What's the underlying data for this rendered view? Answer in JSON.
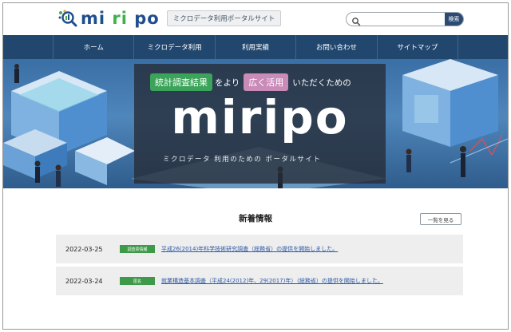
{
  "header": {
    "logo_prefix": "mi",
    "logo_mid": "ri",
    "logo_suffix": " po",
    "logo_subtitle": "ミクロデータ利用ポータルサイト",
    "search_placeholder": "",
    "search_button": "検索"
  },
  "nav": {
    "items": [
      {
        "label": "ホーム"
      },
      {
        "label": "ミクロデータ利用"
      },
      {
        "label": "利用実績"
      },
      {
        "label": "お問い合わせ"
      },
      {
        "label": "サイトマップ"
      }
    ]
  },
  "hero": {
    "tag1": "統計調査結果",
    "text1": "をより",
    "tag2": "広く活用",
    "text2": "いただくための",
    "title": "miripo",
    "subtitle": "ミクロデータ 利用のための ポータルサイト"
  },
  "news": {
    "heading": "新着情報",
    "all_button": "一覧を見る",
    "items": [
      {
        "date": "2022-03-25",
        "tag": "調査票情報",
        "title": "平成26(2014)年科学技術研究調査（総務省）の提供を開始しました。"
      },
      {
        "date": "2022-03-24",
        "tag": "匿名",
        "title": "就業構造基本調査（平成24(2012)年、29(2017)年）（総務省）の提供を開始しました。"
      }
    ]
  },
  "colors": {
    "nav_bg": "#21476f",
    "brand_blue": "#1f4e8f",
    "brand_green": "#3fb04b",
    "tag_green": "#3ba45a",
    "tag_pink": "#c98bb8",
    "news_tag": "#3e9a49",
    "link": "#2a57a6"
  },
  "icons": {
    "logo": "magnifier-logo-icon",
    "search": "search-icon"
  }
}
